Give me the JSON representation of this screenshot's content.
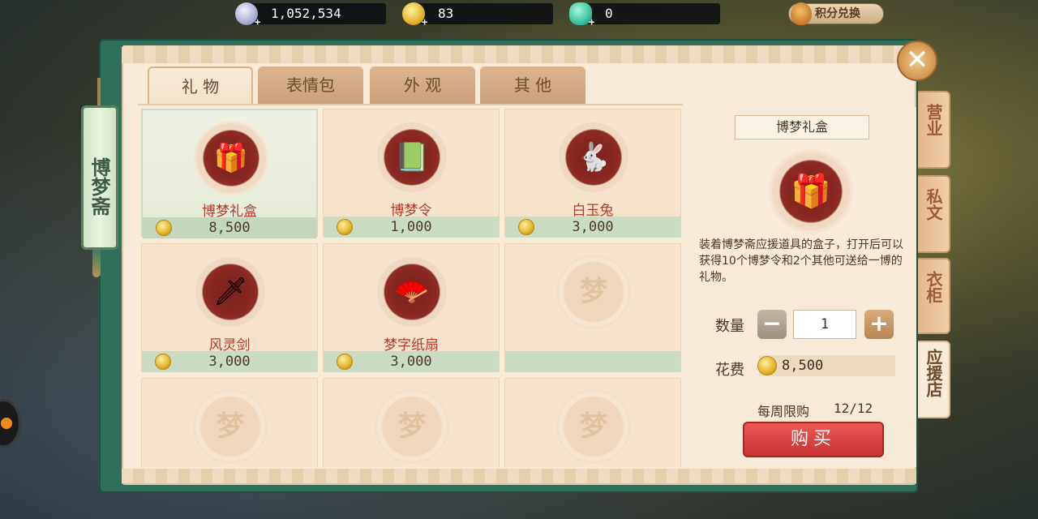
{
  "currencies": {
    "silver": {
      "value": "1,052,534",
      "icon": "silver-coin-icon"
    },
    "gold": {
      "value": "83",
      "icon": "dream-coin-icon"
    },
    "jade": {
      "value": "0",
      "icon": "jade-icon"
    },
    "exchange_label": "积分兑换"
  },
  "shop_sign": "博梦斋",
  "tabs": [
    {
      "label": "礼 物",
      "active": true
    },
    {
      "label": "表情包",
      "active": false
    },
    {
      "label": "外 观",
      "active": false
    },
    {
      "label": "其 他",
      "active": false
    }
  ],
  "side_tabs": [
    {
      "label": "营业",
      "active": false
    },
    {
      "label": "私文",
      "active": false
    },
    {
      "label": "衣柜",
      "active": false
    },
    {
      "label": "应援店",
      "active": true
    }
  ],
  "items": [
    {
      "name": "博梦礼盒",
      "price": "8,500",
      "glyph": "🎁",
      "selected": true
    },
    {
      "name": "博梦令",
      "price": "1,000",
      "glyph": "📗",
      "selected": false
    },
    {
      "name": "白玉兔",
      "price": "3,000",
      "glyph": "🐇",
      "selected": false
    },
    {
      "name": "风灵剑",
      "price": "3,000",
      "glyph": "🗡",
      "selected": false
    },
    {
      "name": "梦字纸扇",
      "price": "3,000",
      "glyph": "🪭",
      "selected": false
    },
    {
      "name": "",
      "price": "",
      "glyph": "梦",
      "selected": false
    },
    {
      "name": "",
      "price": "",
      "glyph": "梦",
      "selected": false
    },
    {
      "name": "",
      "price": "",
      "glyph": "梦",
      "selected": false
    },
    {
      "name": "",
      "price": "",
      "glyph": "梦",
      "selected": false
    }
  ],
  "detail": {
    "title": "博梦礼盒",
    "glyph": "🎁",
    "description": "装着博梦斋应援道具的盒子，打开后可以获得10个博梦令和2个其他可送给一博的礼物。",
    "quantity_label": "数量",
    "quantity": "1",
    "minus": "−",
    "plus": "+",
    "cost_label": "花费",
    "cost": "8,500",
    "limit_label": "每周限购",
    "limit_value": "12/12",
    "buy_label": "购买"
  },
  "close_glyph": "✕"
}
